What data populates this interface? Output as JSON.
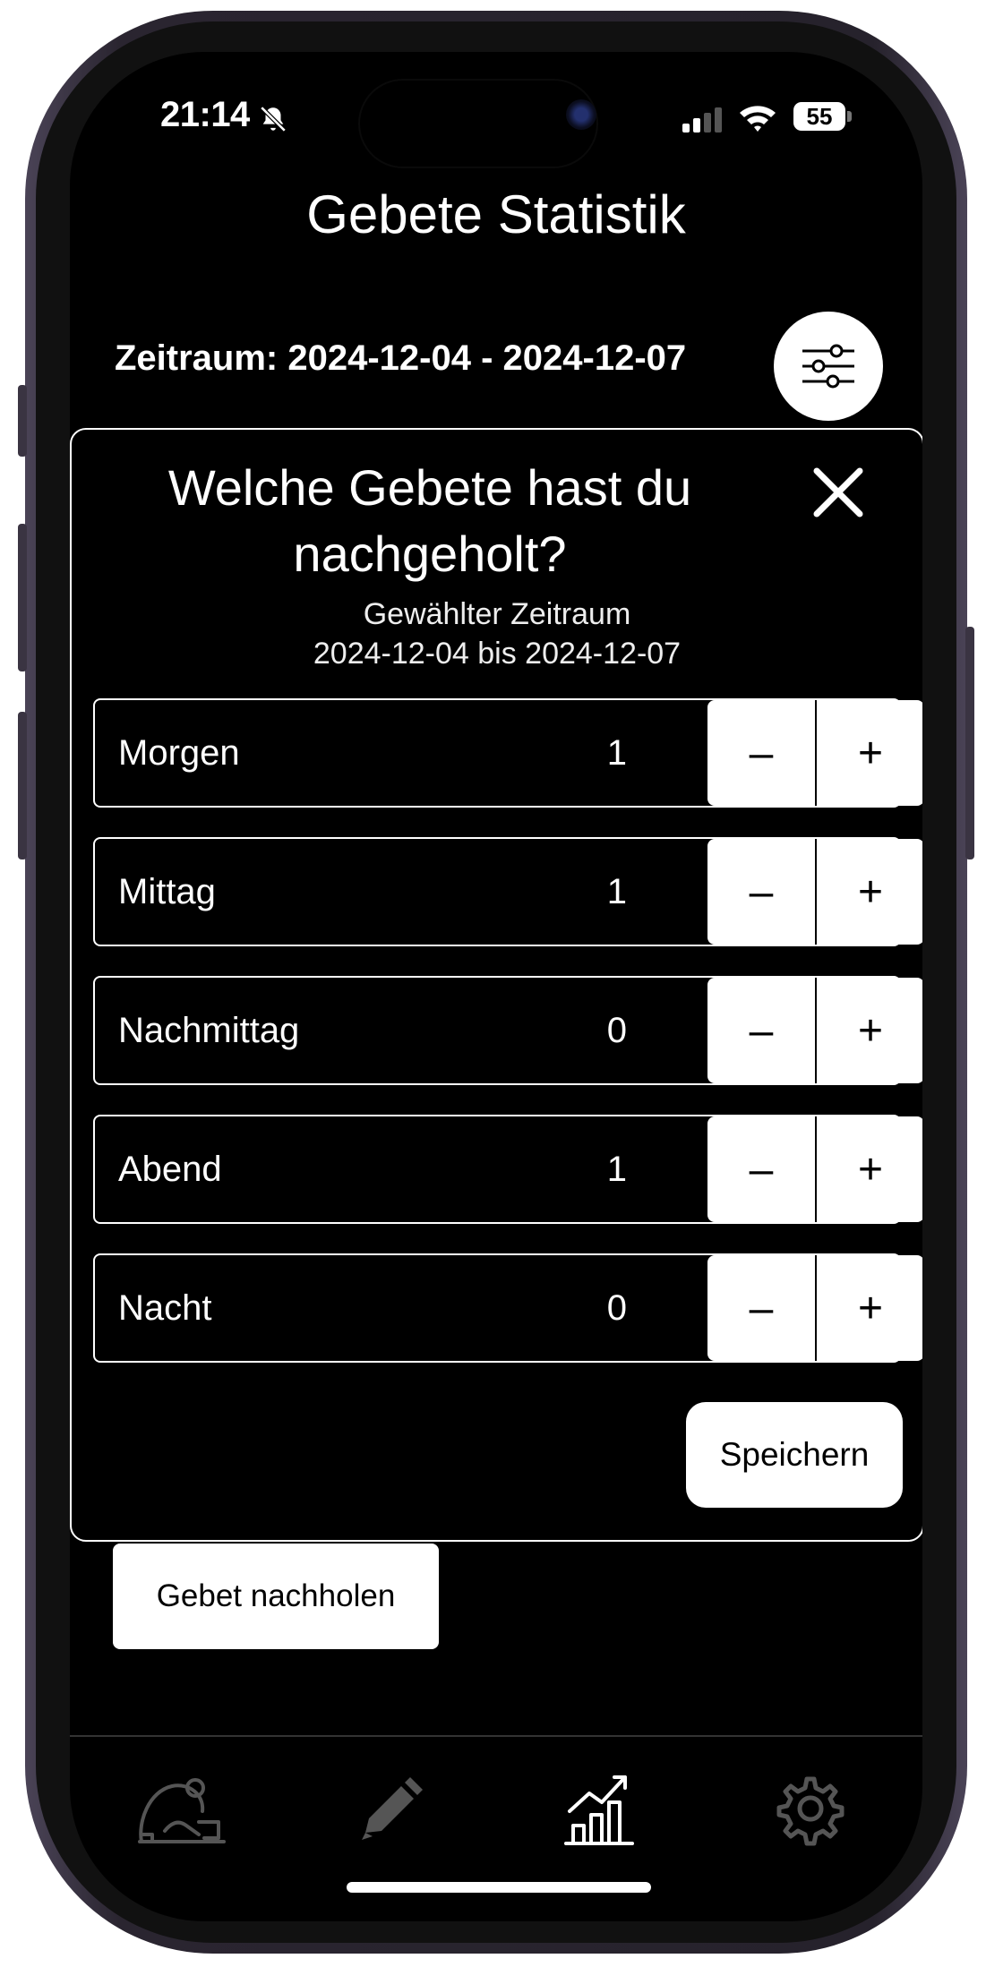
{
  "status_bar": {
    "time": "21:14",
    "battery": "55",
    "icons": [
      "bell-slash-icon",
      "cellular-signal-icon",
      "wifi-icon",
      "battery-icon"
    ]
  },
  "header": {
    "title": "Gebete Statistik",
    "range_label": "Zeitraum: 2024-12-04 - 2024-12-07"
  },
  "modal": {
    "title": "Welche Gebete hast du nachgeholt?",
    "subtitle": "Gewählter Zeitraum",
    "range": "2024-12-04 bis 2024-12-07",
    "rows": [
      {
        "label": "Morgen",
        "value": "1",
        "minus": "–",
        "plus": "+"
      },
      {
        "label": "Mittag",
        "value": "1",
        "minus": "–",
        "plus": "+"
      },
      {
        "label": "Nachmittag",
        "value": "0",
        "minus": "–",
        "plus": "+"
      },
      {
        "label": "Abend",
        "value": "1",
        "minus": "–",
        "plus": "+"
      },
      {
        "label": "Nacht",
        "value": "0",
        "minus": "–",
        "plus": "+"
      }
    ],
    "save_label": "Speichern"
  },
  "actions": {
    "nachholen_label": "Gebet nachholen"
  },
  "tabbar": {
    "icons": [
      "prayer-icon",
      "pencil-icon",
      "chart-icon",
      "gear-icon"
    ],
    "active": "chart-icon"
  },
  "colors": {
    "background": "#000000",
    "foreground": "#ffffff",
    "inactive_icon": "#555555"
  }
}
